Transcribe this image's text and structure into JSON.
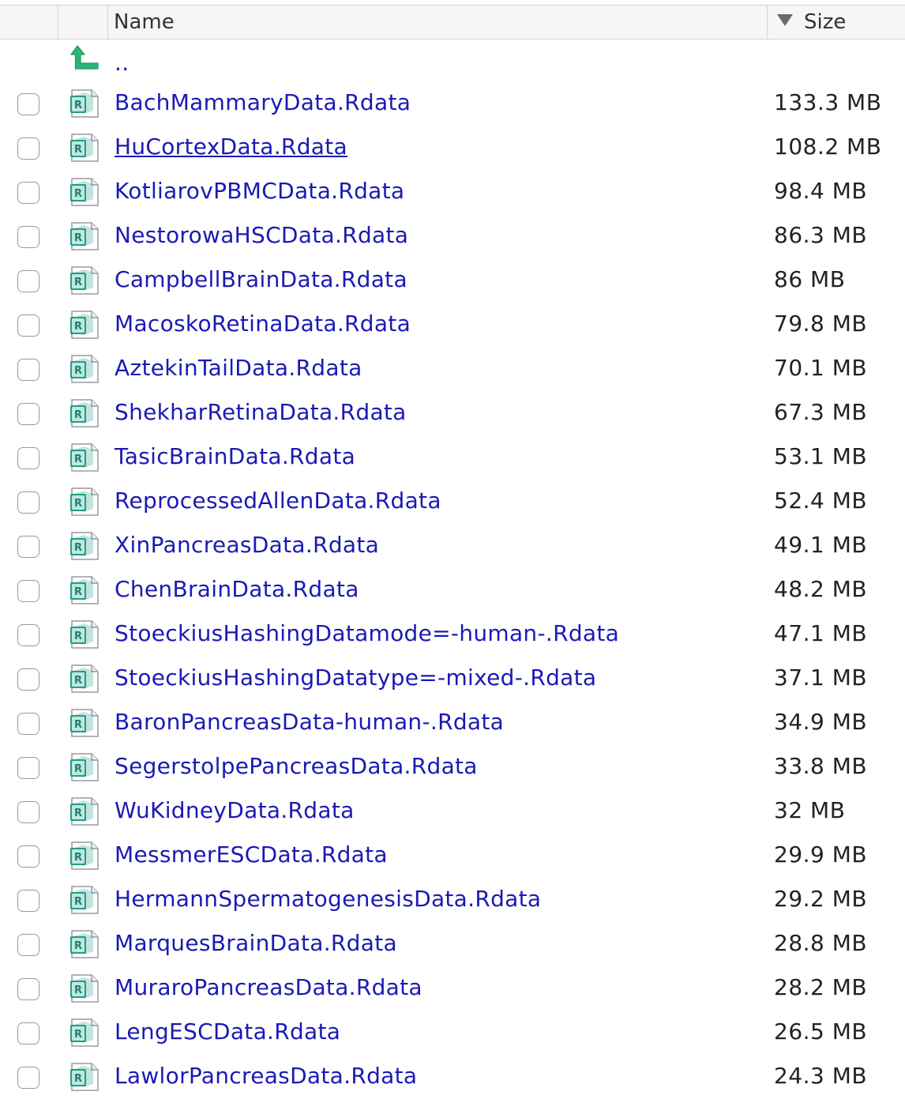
{
  "header": {
    "name_label": "Name",
    "size_label": "Size",
    "sort": "descending"
  },
  "parent_dir": {
    "label": "..",
    "icon": "up-arrow-icon"
  },
  "files": [
    {
      "name": "BachMammaryData.Rdata",
      "size": "133.3 MB"
    },
    {
      "name": "HuCortexData.Rdata",
      "size": "108.2 MB",
      "hovered": true
    },
    {
      "name": "KotliarovPBMCData.Rdata",
      "size": "98.4 MB"
    },
    {
      "name": "NestorowaHSCData.Rdata",
      "size": "86.3 MB"
    },
    {
      "name": "CampbellBrainData.Rdata",
      "size": "86 MB"
    },
    {
      "name": "MacoskoRetinaData.Rdata",
      "size": "79.8 MB"
    },
    {
      "name": "AztekinTailData.Rdata",
      "size": "70.1 MB"
    },
    {
      "name": "ShekharRetinaData.Rdata",
      "size": "67.3 MB"
    },
    {
      "name": "TasicBrainData.Rdata",
      "size": "53.1 MB"
    },
    {
      "name": "ReprocessedAllenData.Rdata",
      "size": "52.4 MB"
    },
    {
      "name": "XinPancreasData.Rdata",
      "size": "49.1 MB"
    },
    {
      "name": "ChenBrainData.Rdata",
      "size": "48.2 MB"
    },
    {
      "name": "StoeckiusHashingDatamode=-human-.Rdata",
      "size": "47.1 MB"
    },
    {
      "name": "StoeckiusHashingDatatype=-mixed-.Rdata",
      "size": "37.1 MB"
    },
    {
      "name": "BaronPancreasData-human-.Rdata",
      "size": "34.9 MB"
    },
    {
      "name": "SegerstolpePancreasData.Rdata",
      "size": "33.8 MB"
    },
    {
      "name": "WuKidneyData.Rdata",
      "size": "32 MB"
    },
    {
      "name": "MessmerESCData.Rdata",
      "size": "29.9 MB"
    },
    {
      "name": "HermannSpermatogenesisData.Rdata",
      "size": "29.2 MB"
    },
    {
      "name": "MarquesBrainData.Rdata",
      "size": "28.8 MB"
    },
    {
      "name": "MuraroPancreasData.Rdata",
      "size": "28.2 MB"
    },
    {
      "name": "LengESCData.Rdata",
      "size": "26.5 MB"
    },
    {
      "name": "LawlorPancreasData.Rdata",
      "size": "24.3 MB"
    }
  ],
  "file_icon": "rdata-file-icon",
  "colors": {
    "link": "#1a1ab4",
    "header_bg": "#f6f6f6",
    "up_arrow": "#2bb673",
    "r_icon": "#1f9e8a"
  }
}
